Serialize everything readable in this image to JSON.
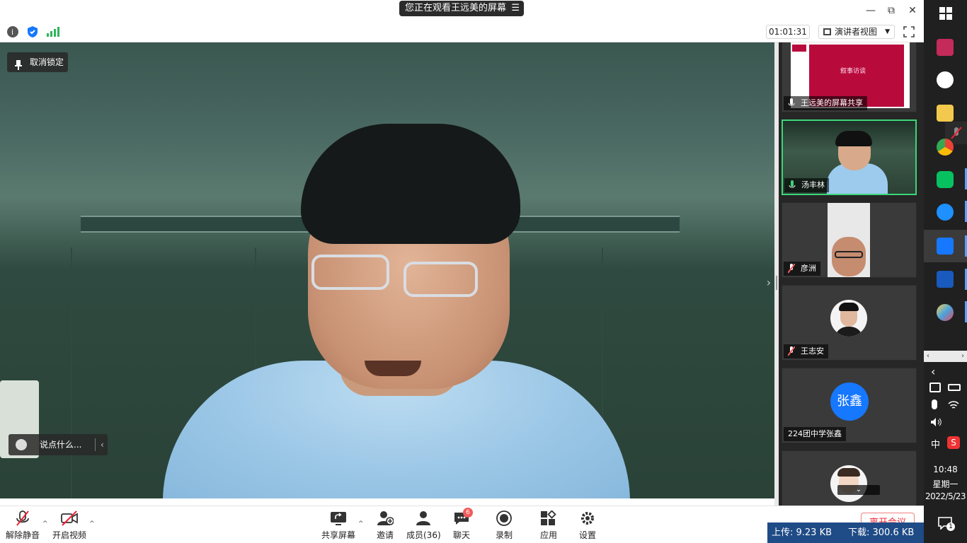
{
  "titlebar": {
    "share_notice": "您正在观看王远美的屏幕",
    "menu_glyph": "☰",
    "minimize": "—",
    "restore": "⧉",
    "close": "✕"
  },
  "inforow": {
    "timer": "01:01:31",
    "view_mode": "演讲者视图",
    "view_caret": "▼"
  },
  "main_video": {
    "unpin_label": "取消锁定",
    "chat_placeholder": "说点什么...",
    "chat_chevron": "‹",
    "collapse_arrow": "›"
  },
  "participants": [
    {
      "name": "王远美的屏幕共享",
      "type": "screen"
    },
    {
      "name": "汤丰林",
      "type": "camera",
      "mic": "on",
      "active": true
    },
    {
      "name": "彦洲",
      "type": "camera",
      "mic": "muted"
    },
    {
      "name": "王志安",
      "type": "photo",
      "mic": "muted"
    },
    {
      "name": "224团中学张鑫",
      "type": "initials",
      "initials": "张鑫"
    },
    {
      "name": "",
      "type": "photo"
    }
  ],
  "slide": {
    "title": "叙事访谈"
  },
  "scroll_indicator": "⌄",
  "toolbar": {
    "mute": "解除静音",
    "video": "开启视频",
    "share": "共享屏幕",
    "invite": "邀请",
    "members": "成员(36)",
    "chat": "聊天",
    "chat_badge": "6",
    "record": "录制",
    "apps": "应用",
    "settings": "设置",
    "leave": "离开会议",
    "caret": "^"
  },
  "netstat": {
    "upload": "上传: 9.23 KB",
    "download": "下载: 300.6 KB"
  },
  "taskbar": {
    "time": "10:48",
    "weekday": "星期一",
    "date": "2022/5/23",
    "ime": "中",
    "notif_count": "1",
    "scroll_left": "‹",
    "scroll_right": "›",
    "back_chevron": "‹"
  },
  "colors": {
    "accent_green": "#3dd57a",
    "leave_red": "#e22233",
    "net_blue": "#1f4b86",
    "avatar_blue": "#1677ff"
  }
}
